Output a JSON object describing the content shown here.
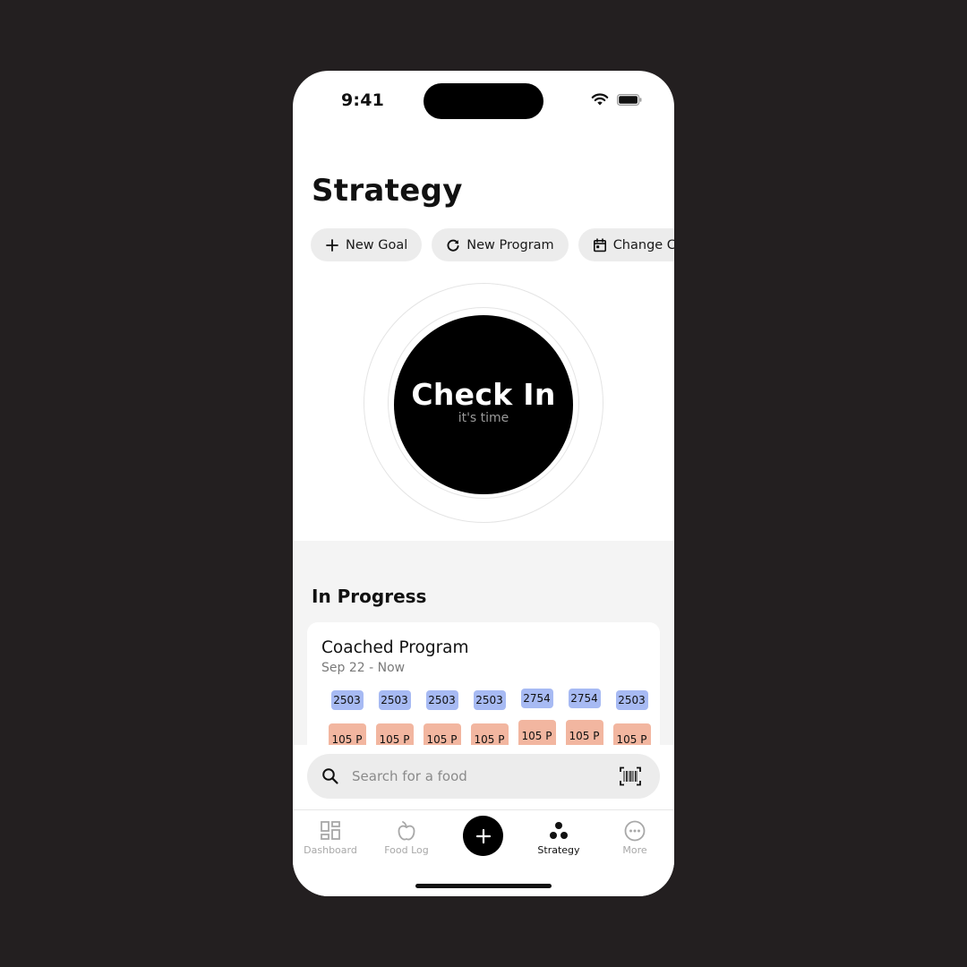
{
  "status_bar": {
    "time": "9:41"
  },
  "header": {
    "title": "Strategy"
  },
  "actions": [
    {
      "icon": "plus-icon",
      "label": "New Goal"
    },
    {
      "icon": "refresh-icon",
      "label": "New Program"
    },
    {
      "icon": "calendar-icon",
      "label": "Change Ch"
    }
  ],
  "checkin": {
    "title": "Check In",
    "subtitle": "it's time"
  },
  "in_progress": {
    "section_title": "In Progress",
    "card": {
      "title": "Coached Program",
      "date_range": "Sep 22 - Now",
      "calories": [
        "2503",
        "2503",
        "2503",
        "2503",
        "2754",
        "2754",
        "2503"
      ],
      "protein": [
        "105 P",
        "105 P",
        "105 P",
        "105 P",
        "105 P",
        "105 P",
        "105 P"
      ],
      "colors": {
        "calories": "#a7baf3",
        "protein": "#f2b6a0"
      }
    }
  },
  "search": {
    "placeholder": "Search for a food",
    "value": ""
  },
  "tabbar": {
    "items": [
      {
        "icon": "dashboard-icon",
        "label": "Dashboard",
        "active": false
      },
      {
        "icon": "apple-icon",
        "label": "Food Log",
        "active": false
      },
      {
        "icon": "plus-icon",
        "label": "",
        "active": false
      },
      {
        "icon": "strategy-icon",
        "label": "Strategy",
        "active": true
      },
      {
        "icon": "more-icon",
        "label": "More",
        "active": false
      }
    ]
  }
}
